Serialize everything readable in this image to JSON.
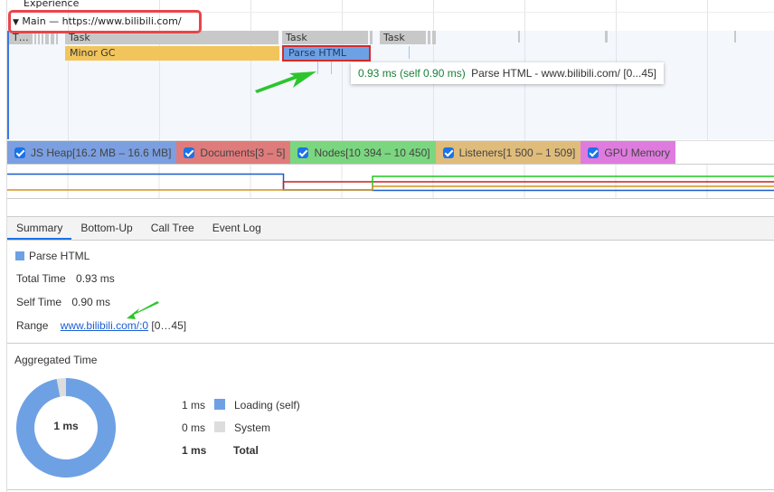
{
  "timeline": {
    "experience_label": "Experience",
    "main_track_label": "Main — https://www.bilibili.com/",
    "tasks": [
      {
        "label": "T…"
      },
      {
        "label": "Task"
      },
      {
        "label": "Task"
      },
      {
        "label": "Task"
      }
    ],
    "minor_gc_label": "Minor GC",
    "parse_html_label": "Parse HTML",
    "tooltip": {
      "time": "0.93 ms (self 0.90 ms)",
      "text": "Parse HTML - www.bilibili.com/ [0...45]"
    }
  },
  "counters": [
    {
      "label": "JS Heap[16.2 MB – 16.6 MB]",
      "checked": true,
      "color": "#7b9fe0"
    },
    {
      "label": "Documents[3 – 5]",
      "checked": true,
      "color": "#e07b7b"
    },
    {
      "label": "Nodes[10 394 – 10 450]",
      "checked": true,
      "color": "#7bd77f"
    },
    {
      "label": "Listeners[1 500 – 1 509]",
      "checked": true,
      "color": "#e0bc7b"
    },
    {
      "label": "GPU Memory",
      "checked": true,
      "color": "#df7bdf"
    }
  ],
  "tabs": [
    {
      "label": "Summary",
      "active": true
    },
    {
      "label": "Bottom-Up",
      "active": false
    },
    {
      "label": "Call Tree",
      "active": false
    },
    {
      "label": "Event Log",
      "active": false
    }
  ],
  "summary": {
    "title": "Parse HTML",
    "swatch_color": "#6ea1e4",
    "total_time_label": "Total Time",
    "total_time_value": "0.93 ms",
    "self_time_label": "Self Time",
    "self_time_value": "0.90 ms",
    "range_label": "Range",
    "range_link": "www.bilibili.com/:0",
    "range_suffix": "[0…45]"
  },
  "aggregated": {
    "title": "Aggregated Time",
    "center_label": "1 ms",
    "legend": [
      {
        "value": "1 ms",
        "label": "Loading (self)",
        "color": "#6ea1e4"
      },
      {
        "value": "0 ms",
        "label": "System",
        "color": "#dddddd"
      }
    ],
    "total_value": "1 ms",
    "total_label": "Total",
    "slices": [
      {
        "name": "Loading (self)",
        "fraction": 0.97
      },
      {
        "name": "System",
        "fraction": 0.03
      }
    ]
  }
}
